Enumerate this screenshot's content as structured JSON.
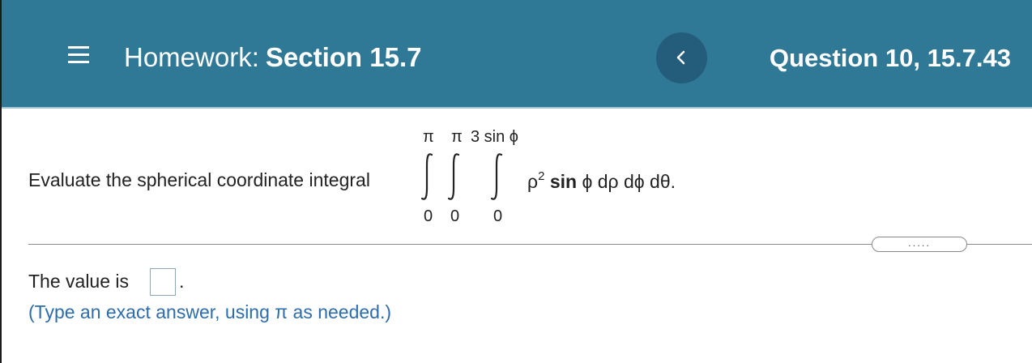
{
  "header": {
    "menu_icon": "hamburger-menu-icon",
    "title_prefix": "Homework:",
    "title_section": "Section 15.7",
    "back_icon": "chevron-left-icon",
    "question_label": "Question 10, 15.7.43",
    "colors": {
      "bar": "#2f7896",
      "back_button": "#245d7c"
    }
  },
  "problem": {
    "prompt": "Evaluate the spherical coordinate integral",
    "outer": {
      "upper": "π",
      "lower": "0"
    },
    "middle": {
      "upper": "π",
      "lower": "0"
    },
    "inner": {
      "upper": "3 sin ϕ",
      "lower": "0"
    },
    "integrand_base": "ρ",
    "integrand_exp": "2",
    "integrand_sin": "sin",
    "integrand_rest": " ϕ dρ dϕ dθ."
  },
  "more_button": {
    "label": "....."
  },
  "answer": {
    "label": "The value is",
    "value": "",
    "suffix": ".",
    "hint": "(Type an exact answer, using π as needed.)"
  }
}
